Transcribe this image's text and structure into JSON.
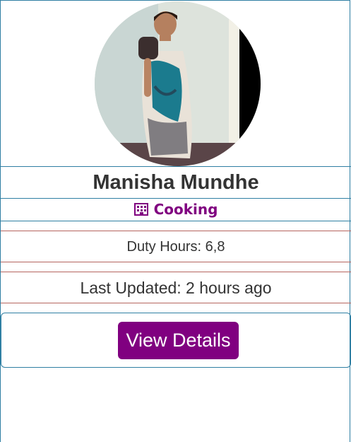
{
  "profile": {
    "name": "Manisha Mundhe",
    "category": "Cooking",
    "category_icon": "building-icon",
    "duty_hours": "Duty Hours: 6,8",
    "last_updated": "Last Updated: 2 hours ago",
    "photo_alt": "profile-photo"
  },
  "actions": {
    "view_details_label": "View Details"
  },
  "colors": {
    "accent": "#800080",
    "border_blue": "#2f7fa3",
    "border_red": "#b5655f",
    "text": "#333333"
  }
}
